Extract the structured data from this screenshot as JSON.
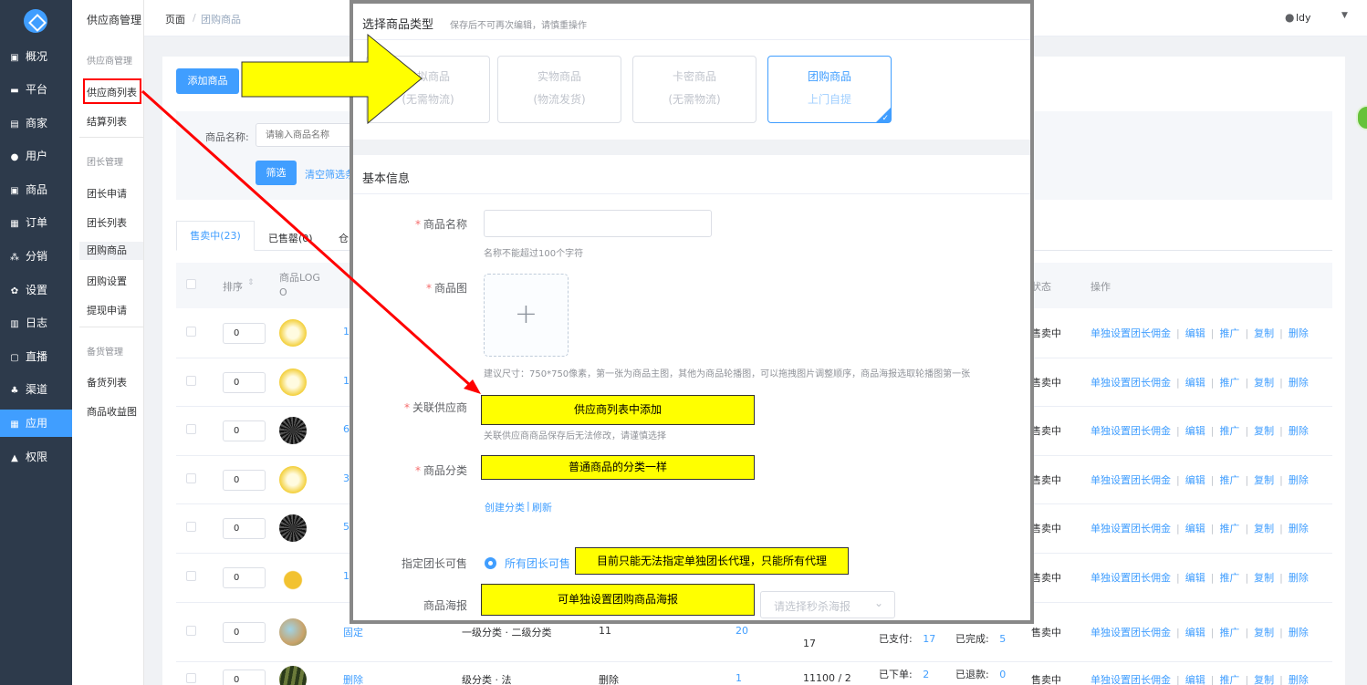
{
  "sidebar": {
    "items": [
      {
        "icon": "chart-icon",
        "label": "概况"
      },
      {
        "icon": "platform-icon",
        "label": "平台"
      },
      {
        "icon": "shop-icon",
        "label": "商家"
      },
      {
        "icon": "user-icon",
        "label": "用户"
      },
      {
        "icon": "goods-icon",
        "label": "商品"
      },
      {
        "icon": "order-icon",
        "label": "订单"
      },
      {
        "icon": "distribution-icon",
        "label": "分销"
      },
      {
        "icon": "settings-icon",
        "label": "设置"
      },
      {
        "icon": "log-icon",
        "label": "日志"
      },
      {
        "icon": "live-icon",
        "label": "直播"
      },
      {
        "icon": "channel-icon",
        "label": "渠道"
      },
      {
        "icon": "apps-icon",
        "label": "应用"
      },
      {
        "icon": "lock-icon",
        "label": "权限"
      }
    ]
  },
  "submenu": {
    "title": "供应商管理",
    "group1": "供应商管理",
    "supplier_list": "供应商列表",
    "settlement_list": "结算列表",
    "group2": "团长管理",
    "leader_apply": "团长申请",
    "leader_list": "团长列表",
    "group_goods": "团购商品",
    "group_settings": "团购设置",
    "withdraw_apply": "提现申请",
    "group3": "备货管理",
    "stock_list": "备货列表",
    "goods_income": "商品收益图"
  },
  "header": {
    "breadcrumb_home": "页面",
    "breadcrumb_sep": "/",
    "breadcrumb_current": "团购商品",
    "username": "ldy"
  },
  "page": {
    "add_button": "添加商品",
    "filter_label": "商品名称:",
    "filter_placeholder": "请输入商品名称",
    "filter_button": "筛选",
    "clear_filter": "清空筛选条",
    "tab_selling": "售卖中(23)",
    "tab_soldout": "已售罄(0)",
    "tab_warehouse": "仓",
    "col_sort": "排序",
    "col_logo": "商品LOGO",
    "col_status": "状态",
    "col_action": "操作"
  },
  "table": {
    "op_commission": "单独设置团长佣金",
    "op_edit": "编辑",
    "op_promote": "推广",
    "op_copy": "复制",
    "op_delete": "删除",
    "rows": [
      {
        "sort": "0",
        "id": "1",
        "status": "售卖中"
      },
      {
        "sort": "0",
        "id": "1",
        "status": "售卖中"
      },
      {
        "sort": "0",
        "id": "6",
        "status": "售卖中"
      },
      {
        "sort": "0",
        "id": "3",
        "status": "售卖中"
      },
      {
        "sort": "0",
        "id": "5",
        "status": "售卖中"
      },
      {
        "sort": "0",
        "id": "1",
        "status": "售卖中"
      },
      {
        "sort": "0",
        "name": "固定",
        "category": "一级分类 · 二级分类",
        "price": "11",
        "stock": "20",
        "sales": "17",
        "paid_label": "已支付:",
        "paid": "17",
        "done_label": "已完成:",
        "done": "5",
        "status": "售卖中"
      },
      {
        "sort": "0",
        "name": "删除",
        "category": "级分类 · 法",
        "price": "删除",
        "stock": "1",
        "sales": "11100 / 2",
        "ordered_label": "已下单:",
        "ordered": "2",
        "refund_label": "已退款:",
        "refund": "0",
        "status": "售卖中"
      }
    ]
  },
  "modal": {
    "title": "选择商品类型",
    "subtitle": "保存后不可再次编辑，请慎重操作",
    "types": [
      {
        "name": "虚拟商品",
        "desc": "(无需物流)"
      },
      {
        "name": "实物商品",
        "desc": "(物流发货)"
      },
      {
        "name": "卡密商品",
        "desc": "(无需物流)"
      },
      {
        "name": "团购商品",
        "desc": "上门自提"
      }
    ],
    "section_basic": "基本信息",
    "name_label": "商品名称",
    "name_hint": "名称不能超过100个字符",
    "image_label": "商品图",
    "image_hint": "建议尺寸：750*750像素，第一张为商品主图，其他为商品轮播图，可以拖拽图片调整顺序，商品海报选取轮播图第一张",
    "supplier_label": "关联供应商",
    "supplier_hint": "关联供应商商品保存后无法修改，请谨慎选择",
    "category_label": "商品分类",
    "create_category": "创建分类",
    "refresh": "刷新",
    "leader_label": "指定团长可售",
    "leader_option": "所有团长可售",
    "poster_label": "商品海报",
    "poster_placeholder": "请选择秒杀海报"
  },
  "annotations": {
    "supplier_note": "供应商列表中添加",
    "category_note": "普通商品的分类一样",
    "leader_note": "目前只能无法指定单独团长代理，只能所有代理",
    "poster_note": "可单独设置团购商品海报"
  },
  "colors": {
    "primary": "#409eff",
    "sidebar": "#2d3a4b",
    "annotation": "#ffff00",
    "arrow": "#ff0000"
  }
}
